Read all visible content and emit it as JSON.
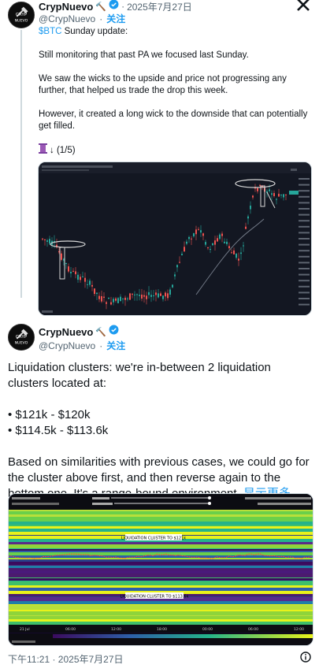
{
  "tweet1": {
    "display_name": "CrypNuevo",
    "name_emoji": "🔨",
    "handle": "@CrypNuevo",
    "separator": "·",
    "date": "2025年7月27日",
    "follow": "关注",
    "avatar_text_top": "CRYP",
    "avatar_text_bottom": "NUEVO",
    "ticker": "$BTC",
    "line1_rest": " Sunday update:",
    "p1": "Still monitoring that past PA we focused last Sunday.",
    "p2": "We saw the wicks to the upside and price not progressing any further, that helped us trade the drop this week.",
    "p3": "However, it created a long wick to the downside that can potentially get filled.",
    "thread_counter": "↓ (1/5)"
  },
  "tweet2": {
    "display_name": "CrypNuevo",
    "name_emoji": "🔨",
    "handle": "@CrypNuevo",
    "follow": "关注",
    "intro": "Liquidation clusters: we're in-between 2 liquidation clusters located at:",
    "bullet1": "• $121k - $120k",
    "bullet2": "• $114.5k - $113.6k",
    "body": "Based on similarities with previous cases, we could go for the cluster above first, and then reverse again to the bottom one. It's a range-bound environment.",
    "show_more": "显示更多",
    "timestamp": "下午11:21 · 2025年7月27日"
  },
  "heatmap": {
    "label_top": "LIQUIDATION CLUSTER TO $121k",
    "label_bottom": "LIQUIDATION CLUSTER TO $113.6k",
    "x_labels": [
      "21 Jul",
      "06:00",
      "12:00",
      "18:00",
      "00:00",
      "06:00",
      "12:00"
    ]
  },
  "colors": {
    "accent": "#1d9bf0",
    "chart_bg": "#131722",
    "up": "#26a69a",
    "down": "#ef5350"
  },
  "icons": {
    "close": "x-icon",
    "verified": "verified-badge-icon",
    "hammer": "hammer-icon",
    "info": "info-icon"
  }
}
